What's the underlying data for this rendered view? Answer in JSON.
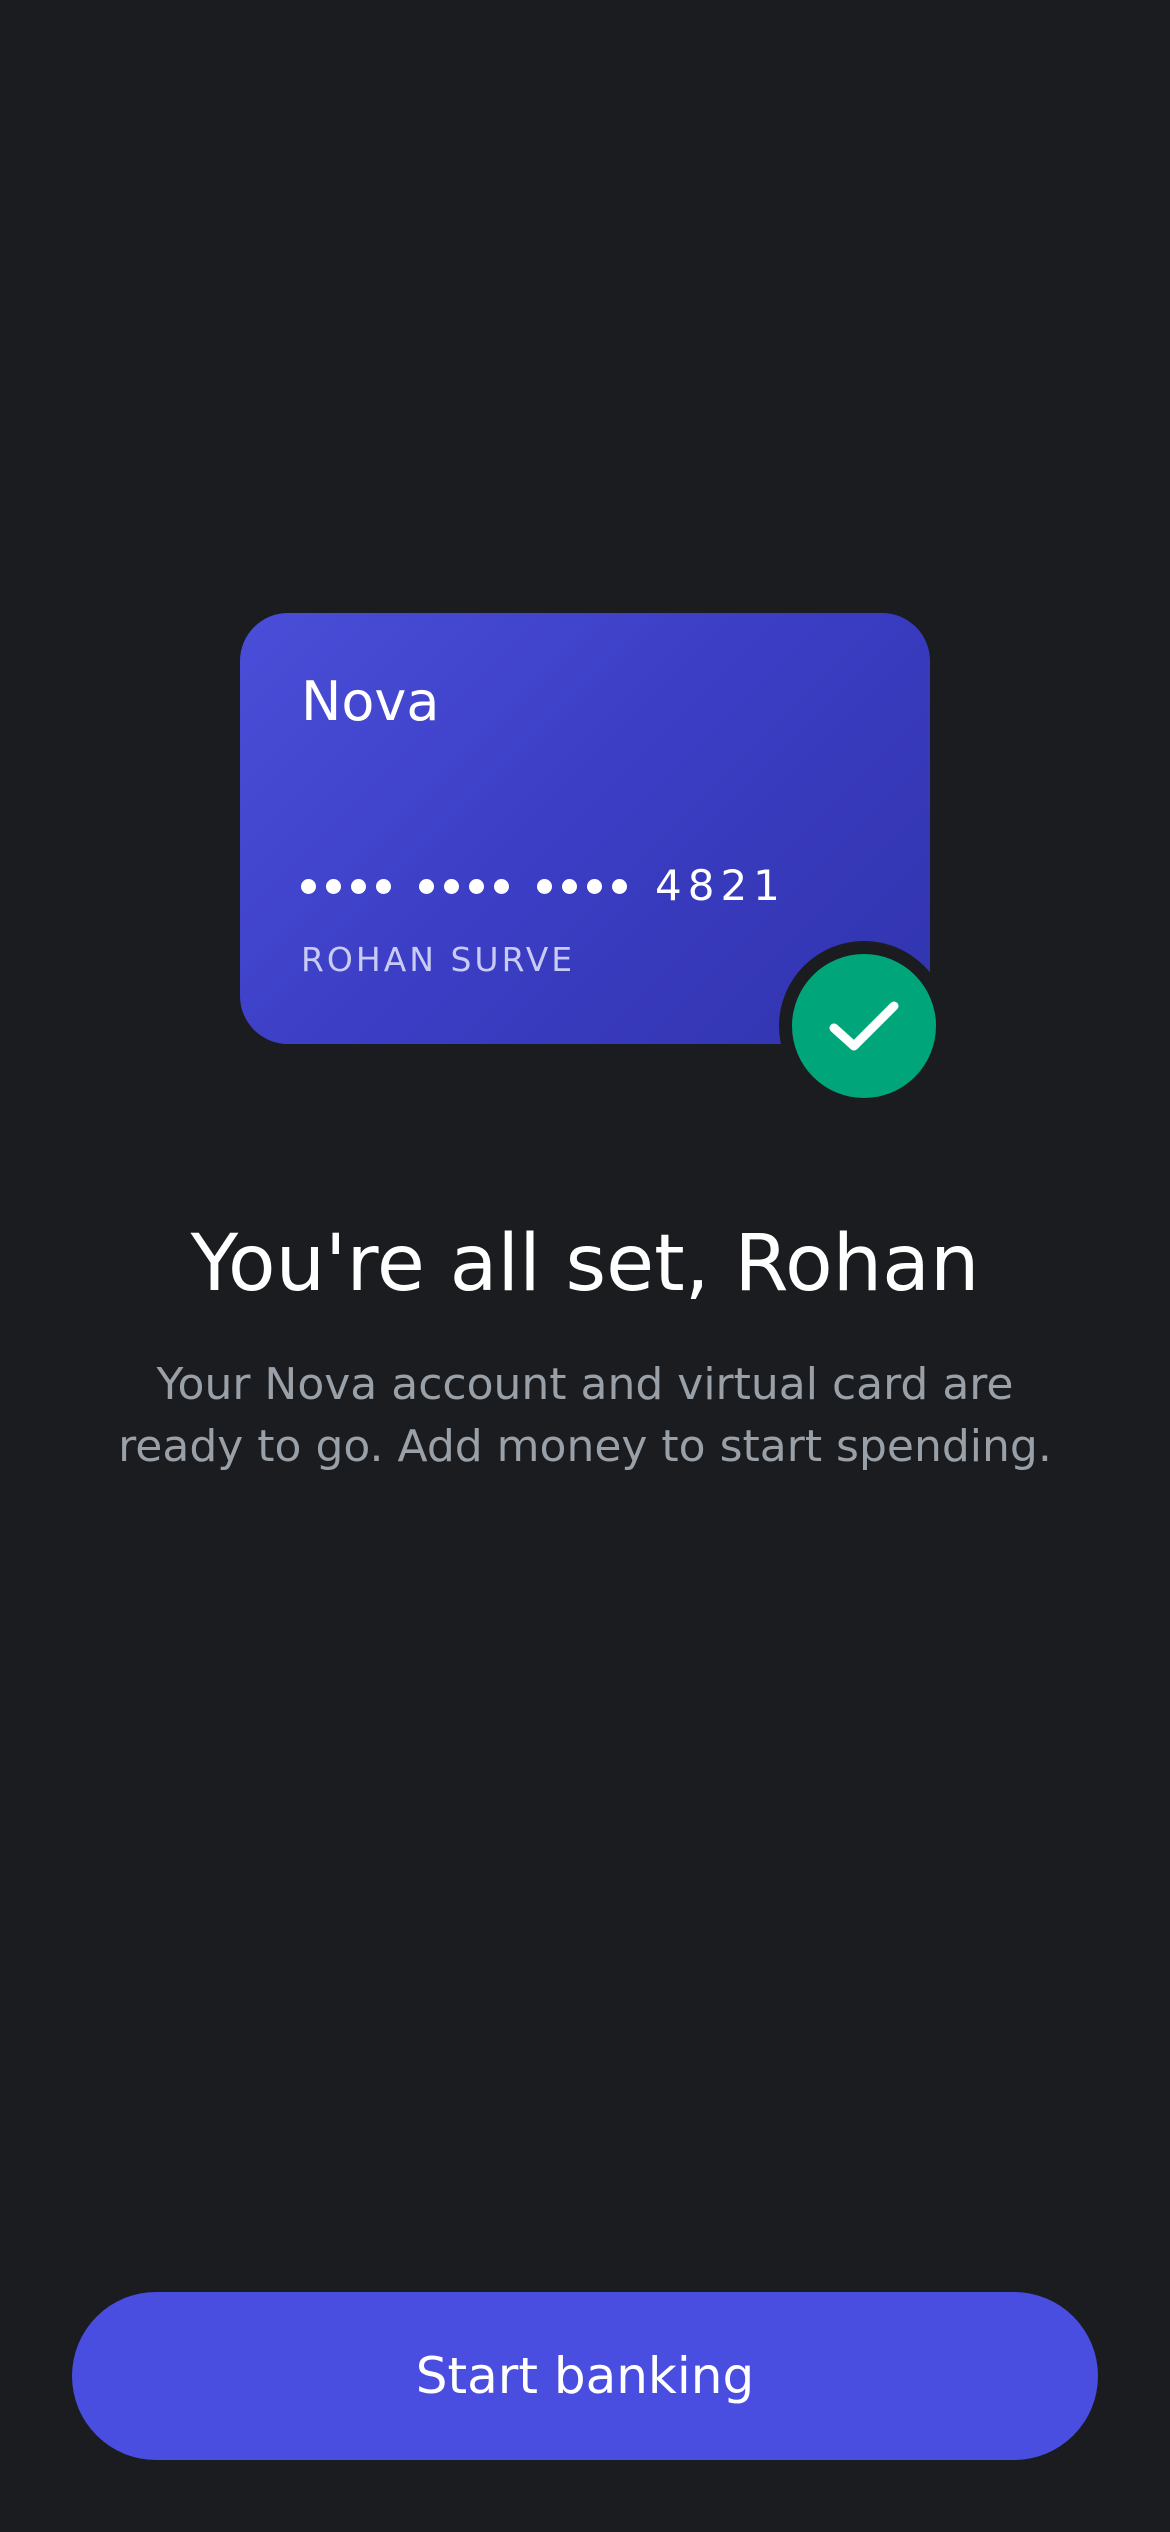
{
  "colors": {
    "background": "#1a1c1f",
    "card_gradient_start": "#4a4ed8",
    "card_gradient_end": "#3134ad",
    "success": "#00a67a",
    "accent": "#4a4ee0",
    "muted_text": "#9aa0a8"
  },
  "card": {
    "brand": "Nova",
    "last4": "4821",
    "holder": "ROHAN SURVE"
  },
  "badge": {
    "icon": "check-icon"
  },
  "headline": "You're all set, Rohan",
  "subcopy": {
    "line1": "Your Nova account and virtual card are",
    "line2": "ready to go. Add money to start spending."
  },
  "cta": {
    "label": "Start banking"
  }
}
